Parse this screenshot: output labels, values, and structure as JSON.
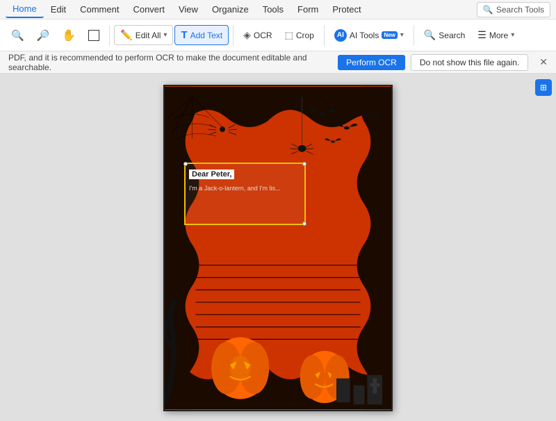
{
  "menubar": {
    "items": [
      {
        "id": "home",
        "label": "Home",
        "active": true
      },
      {
        "id": "edit",
        "label": "Edit"
      },
      {
        "id": "comment",
        "label": "Comment"
      },
      {
        "id": "convert",
        "label": "Convert"
      },
      {
        "id": "view",
        "label": "View"
      },
      {
        "id": "organize",
        "label": "Organize"
      },
      {
        "id": "tools",
        "label": "Tools"
      },
      {
        "id": "form",
        "label": "Form"
      },
      {
        "id": "protect",
        "label": "Protect"
      }
    ],
    "search_label": "Search Tools",
    "search_icon": "🔍"
  },
  "toolbar": {
    "zoom_out_label": "🔍",
    "zoom_in_label": "🔍",
    "hand_label": "✋",
    "select_label": "⬜",
    "edit_all_label": "Edit All",
    "edit_icon": "✏️",
    "add_text_label": "Add Text",
    "add_text_icon": "T",
    "ocr_label": "OCR",
    "ocr_icon": "◈",
    "crop_label": "Crop",
    "crop_icon": "⬜",
    "ai_tools_label": "AI Tools",
    "ai_icon": "⬡",
    "search_label": "Search",
    "search_icon": "🔍",
    "more_label": "More",
    "more_icon": "☰"
  },
  "notification": {
    "message": "PDF, and it is recommended to perform OCR to make the document editable and searchable.",
    "perform_ocr_label": "Perform OCR",
    "dismiss_label": "Do not show this file again.",
    "close_icon": "✕"
  },
  "document": {
    "text_line_1": "Dear Peter,",
    "text_line_2": "I'm a Jack-o-lantern, and I'm lis...",
    "side_panel_icon": "⊞"
  }
}
